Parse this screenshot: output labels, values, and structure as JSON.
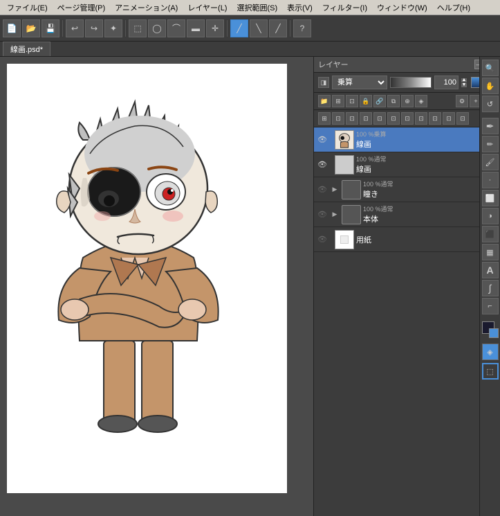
{
  "menubar": {
    "items": [
      "ファイル(E)",
      "ページ管理(P)",
      "アニメーション(A)",
      "レイヤー(L)",
      "選択範囲(S)",
      "表示(V)",
      "フィルター(I)",
      "ウィンドウ(W)",
      "ヘルプ(H)"
    ]
  },
  "tabbar": {
    "tabs": [
      {
        "label": "線画.psd*",
        "active": true
      }
    ]
  },
  "layer_panel": {
    "title": "レイヤー",
    "close_btn": "—",
    "blend_mode": "乗算",
    "opacity": "100",
    "layers": [
      {
        "id": 1,
        "visible": true,
        "locked": false,
        "blend": "100 %乗算",
        "name": "線画",
        "selected": true,
        "thumb_type": "character"
      },
      {
        "id": 2,
        "visible": true,
        "locked": false,
        "blend": "100 %通常",
        "name": "線画",
        "selected": false,
        "thumb_type": "checker"
      },
      {
        "id": 3,
        "visible": false,
        "locked": false,
        "blend": "100 %通常",
        "name": "瞳き",
        "selected": false,
        "has_expand": true,
        "thumb_type": "checker"
      },
      {
        "id": 4,
        "visible": false,
        "locked": false,
        "blend": "100 %通常",
        "name": "本体",
        "selected": false,
        "has_expand": true,
        "thumb_type": "checker"
      },
      {
        "id": 5,
        "visible": false,
        "locked": false,
        "blend": "",
        "name": "用紙",
        "selected": false,
        "thumb_type": "white"
      }
    ]
  },
  "right_toolbar": {
    "tools": [
      {
        "name": "navigate",
        "icon": "🔍"
      },
      {
        "name": "hand",
        "icon": "✋"
      },
      {
        "name": "rotate",
        "icon": "↺"
      },
      {
        "name": "zoom-in",
        "icon": "+"
      },
      {
        "name": "pen",
        "icon": "✒"
      },
      {
        "name": "pencil",
        "icon": "✏"
      },
      {
        "name": "brush",
        "icon": "🖌"
      },
      {
        "name": "eraser",
        "icon": "◻"
      },
      {
        "name": "fill",
        "icon": "⬛"
      },
      {
        "name": "selection",
        "icon": "⬚"
      },
      {
        "name": "text",
        "icon": "A"
      },
      {
        "name": "curve",
        "icon": "∫"
      },
      {
        "name": "color-primary",
        "icon": ""
      },
      {
        "name": "color-secondary",
        "icon": ""
      }
    ]
  }
}
